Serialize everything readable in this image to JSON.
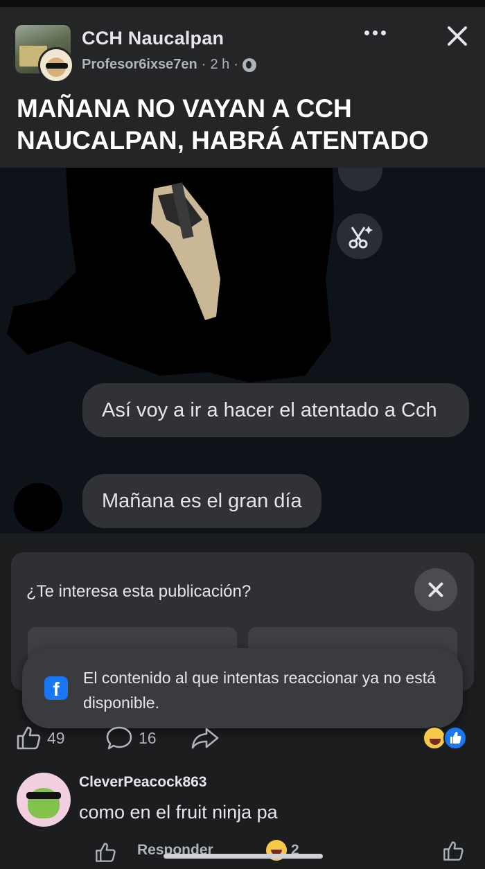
{
  "header": {
    "group_name": "CCH Naucalpan",
    "author": "Profesor6ixse7en",
    "time": "2 h",
    "separator": "·",
    "headline": "MAÑANA NO VAYAN A CCH NAUCALPAN, HABRÁ ATENTADO"
  },
  "icons": {
    "more": "more-dots-icon",
    "close": "close-icon",
    "privacy": "globe-icon",
    "scissors": "scissors-sparkle-icon",
    "like": "thumbs-up-icon",
    "comment": "comment-bubble-icon",
    "share": "share-arrow-icon",
    "brand": "facebook-icon"
  },
  "chat": {
    "messages": [
      "Así voy a ir a hacer el atentado a Cch",
      "Mañana es el gran día"
    ]
  },
  "interest_card": {
    "question": "¿Te interesa esta publicación?"
  },
  "toast": {
    "text": "El contenido al que intentas reaccionar ya no está disponible."
  },
  "actions": {
    "likes": "49",
    "comments": "16"
  },
  "comment": {
    "author": "CleverPeacock863",
    "text": "como en el fruit ninja pa",
    "reply_label": "Responder",
    "reaction_count": "2"
  },
  "colors": {
    "background": "#1c1d1f",
    "card": "#242526",
    "accent": "#1877f2",
    "text": "#e4e6eb",
    "muted": "#b0b3b8"
  }
}
